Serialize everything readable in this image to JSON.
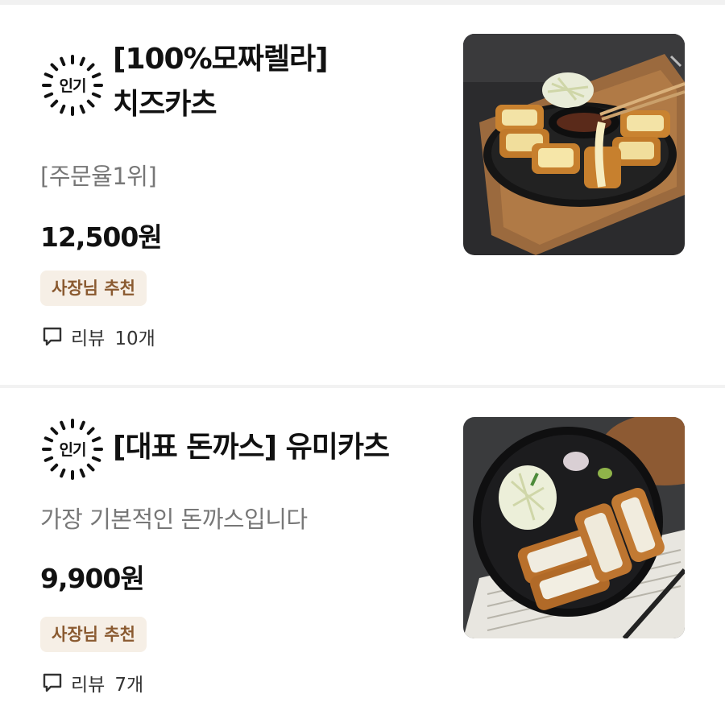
{
  "menu_items": [
    {
      "badge": "인기",
      "title_line1": "[100%모짜렐라]",
      "title_line2": "치즈카츠",
      "subtitle": "[주문율1위]",
      "price": "12,500원",
      "tag": "사장님 추천",
      "review_label": "리뷰",
      "review_count": "10개",
      "image_icon": "cheese-katsu-photo"
    },
    {
      "badge": "인기",
      "title_line1": "[대표 돈까스] 유미카츠",
      "subtitle": "가장 기본적인 돈까스입니다",
      "price": "9,900원",
      "tag": "사장님 추천",
      "review_label": "리뷰",
      "review_count": "7개",
      "image_icon": "pork-cutlet-photo"
    }
  ],
  "colors": {
    "tag_bg": "#f6efe6",
    "tag_text": "#8a5a30",
    "subtitle": "#777777"
  }
}
